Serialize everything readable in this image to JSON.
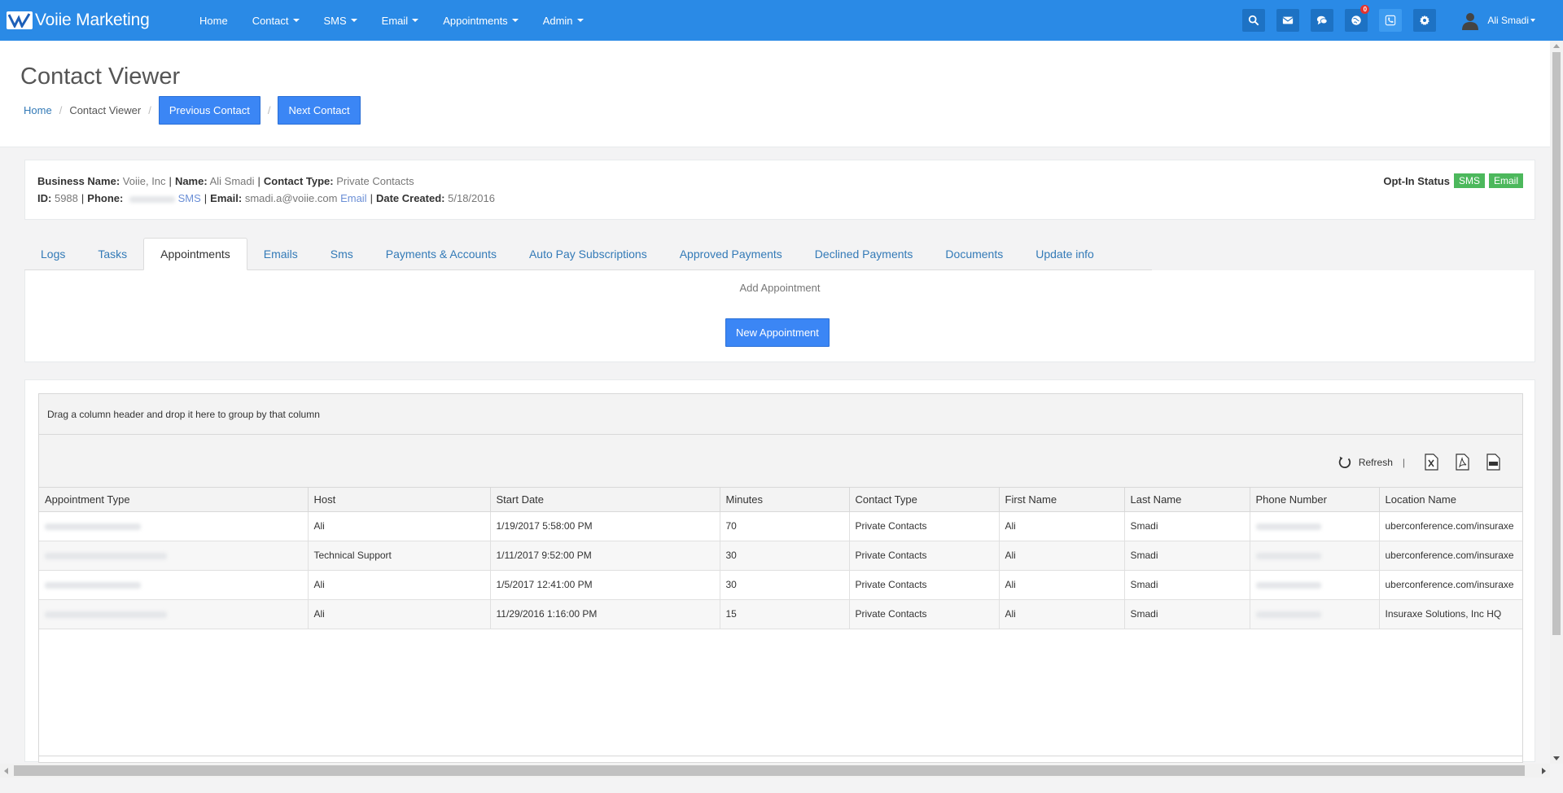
{
  "navbar": {
    "brand": "Voiie Marketing",
    "menu": [
      {
        "label": "Home",
        "dropdown": false
      },
      {
        "label": "Contact",
        "dropdown": true
      },
      {
        "label": "SMS",
        "dropdown": true
      },
      {
        "label": "Email",
        "dropdown": true
      },
      {
        "label": "Appointments",
        "dropdown": true
      },
      {
        "label": "Admin",
        "dropdown": true
      }
    ],
    "icons": [
      "search-icon",
      "envelope-icon",
      "chat-icon",
      "globe-icon",
      "phone-icon",
      "gear-icon"
    ],
    "notification_count": "0",
    "user_name": "Ali Smadi"
  },
  "page": {
    "title": "Contact Viewer",
    "breadcrumb": {
      "home": "Home",
      "current": "Contact Viewer"
    },
    "prev_button": "Previous Contact",
    "next_button": "Next Contact"
  },
  "contact": {
    "business_name_label": "Business Name:",
    "business_name": "Voiie, Inc",
    "name_label": "Name:",
    "name": "Ali Smadi",
    "contact_type_label": "Contact Type:",
    "contact_type": "Private Contacts",
    "id_label": "ID:",
    "id": "5988",
    "phone_label": "Phone:",
    "phone_sms_link": "SMS",
    "email_label": "Email",
    "email": "smadi.a@voiie.com",
    "email_link": "Email",
    "date_created_label": "Date Created:",
    "date_created": "5/18/2016",
    "opt_in_label": "Opt-In Status",
    "opt_in_sms": "SMS",
    "opt_in_email": "Email"
  },
  "tabs": [
    "Logs",
    "Tasks",
    "Appointments",
    "Emails",
    "Sms",
    "Payments & Accounts",
    "Auto Pay Subscriptions",
    "Approved Payments",
    "Declined Payments",
    "Documents",
    "Update info"
  ],
  "active_tab": "Appointments",
  "appointment_panel": {
    "label": "Add Appointment",
    "button": "New Appointment"
  },
  "grid": {
    "group_hint": "Drag a column header and drop it here to group by that column",
    "refresh_label": "Refresh",
    "separator": "|",
    "columns": [
      "Appointment Type",
      "Host",
      "Start Date",
      "Minutes",
      "Contact Type",
      "First Name",
      "Last Name",
      "Phone Number",
      "Location Name"
    ],
    "rows": [
      {
        "host": "Ali",
        "start": "1/19/2017 5:58:00 PM",
        "minutes": "70",
        "contact_type": "Private Contacts",
        "first": "Ali",
        "last": "Smadi",
        "location": "uberconference.com/insuraxe"
      },
      {
        "host": "Technical Support",
        "start": "1/11/2017 9:52:00 PM",
        "minutes": "30",
        "contact_type": "Private Contacts",
        "first": "Ali",
        "last": "Smadi",
        "location": "uberconference.com/insuraxe"
      },
      {
        "host": "Ali",
        "start": "1/5/2017 12:41:00 PM",
        "minutes": "30",
        "contact_type": "Private Contacts",
        "first": "Ali",
        "last": "Smadi",
        "location": "uberconference.com/insuraxe"
      },
      {
        "host": "Ali",
        "start": "11/29/2016 1:16:00 PM",
        "minutes": "15",
        "contact_type": "Private Contacts",
        "first": "Ali",
        "last": "Smadi",
        "location": "Insuraxe Solutions, Inc HQ"
      }
    ]
  }
}
